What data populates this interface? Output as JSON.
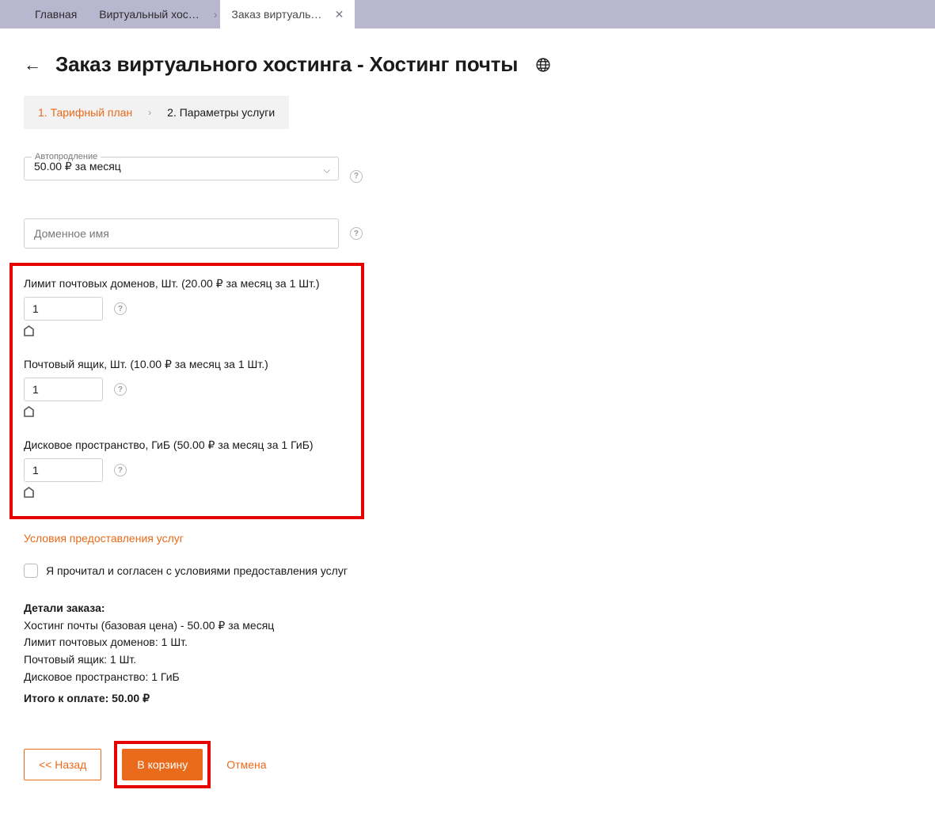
{
  "tabs": {
    "home": "Главная",
    "vhost": "Виртуальный хос…",
    "order": "Заказ виртуальн…"
  },
  "page": {
    "title": "Заказ виртуального хостинга - Хостинг почты"
  },
  "steps": {
    "one": "1. Тарифный план",
    "two": "2. Параметры услуги"
  },
  "autoprolong": {
    "label": "Автопродление",
    "value": "50.00 ₽ за месяц"
  },
  "domain": {
    "placeholder": "Доменное имя"
  },
  "params": {
    "mail_domains": {
      "label": "Лимит почтовых доменов, Шт. (20.00 ₽ за месяц за 1 Шт.)",
      "value": "1"
    },
    "mailbox": {
      "label": "Почтовый ящик, Шт. (10.00 ₽ за месяц за 1 Шт.)",
      "value": "1"
    },
    "disk": {
      "label": "Дисковое пространство, ГиБ (50.00 ₽ за месяц за 1 ГиБ)",
      "value": "1"
    }
  },
  "terms_link": "Условия предоставления услуг",
  "agree_label": "Я прочитал и согласен с условиями предоставления услуг",
  "details": {
    "heading": "Детали заказа:",
    "line1": "Хостинг почты (базовая цена) - 50.00 ₽ за месяц",
    "line2": "Лимит почтовых доменов: 1 Шт.",
    "line3": "Почтовый ящик: 1 Шт.",
    "line4": "Дисковое пространство: 1 ГиБ",
    "total": "Итого к оплате: 50.00 ₽"
  },
  "footer": {
    "back": "<<  Назад",
    "cart": "В корзину",
    "cancel": "Отмена"
  }
}
